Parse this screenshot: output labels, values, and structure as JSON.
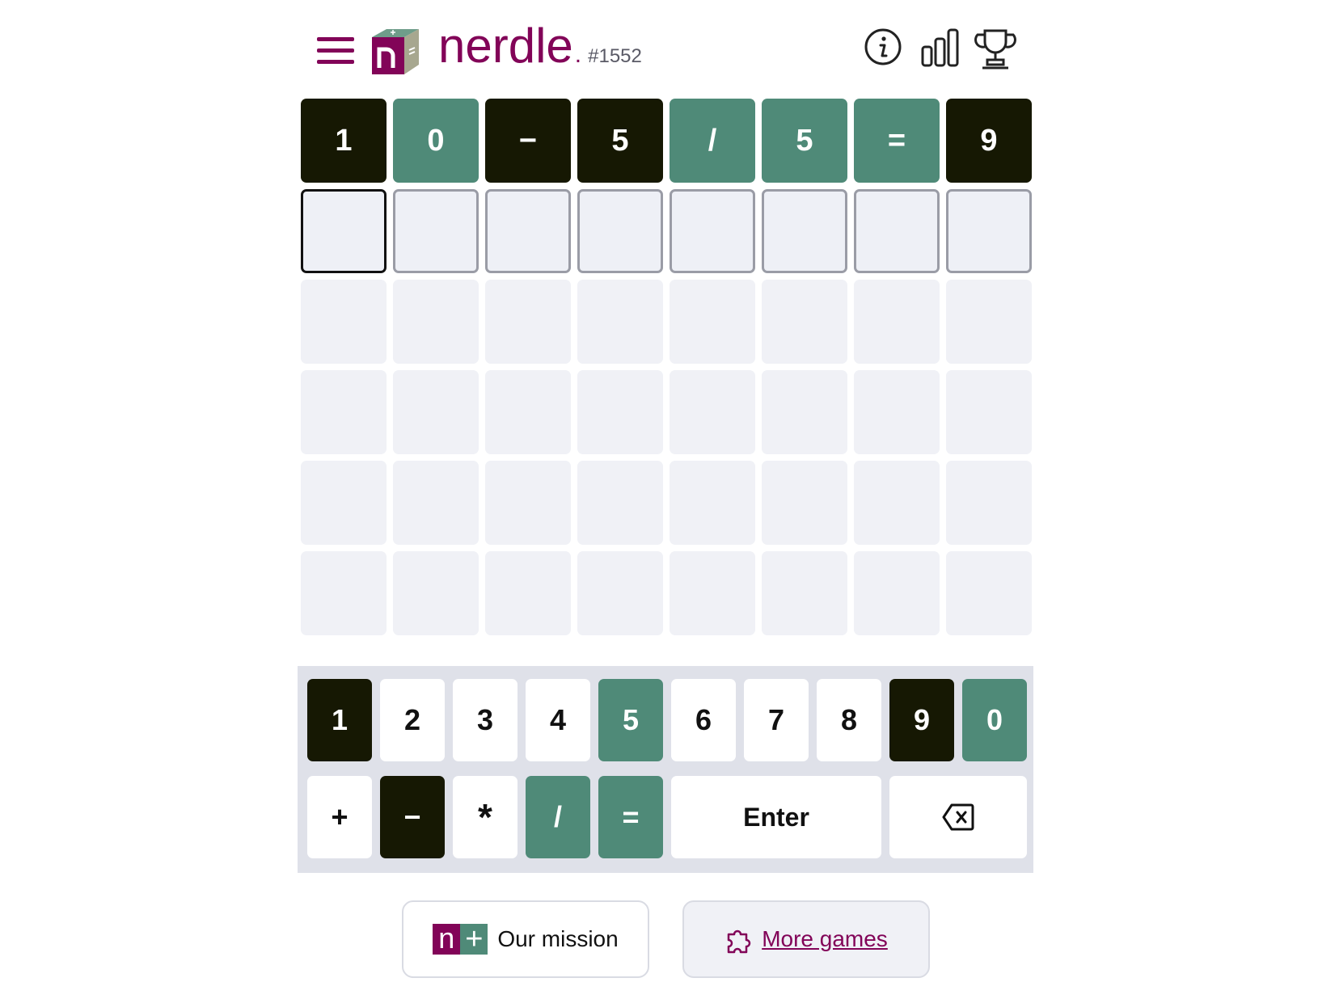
{
  "header": {
    "brand": "nerdle",
    "dot": ".",
    "puzzle_number": "#1552",
    "icons": [
      "menu-icon",
      "nerdle-logo-icon",
      "info-icon",
      "stats-icon",
      "trophy-icon"
    ]
  },
  "colors": {
    "brand": "#820458",
    "correct": "#4f8a78",
    "absent": "#161803",
    "empty": "#f0f1f6"
  },
  "board": {
    "guess_1": [
      {
        "char": "1",
        "state": "absent"
      },
      {
        "char": "0",
        "state": "present"
      },
      {
        "char": "−",
        "state": "absent"
      },
      {
        "char": "5",
        "state": "absent"
      },
      {
        "char": "/",
        "state": "present"
      },
      {
        "char": "5",
        "state": "present"
      },
      {
        "char": "=",
        "state": "present"
      },
      {
        "char": "9",
        "state": "absent"
      }
    ]
  },
  "keyboard": {
    "row1": [
      {
        "label": "1",
        "state": "absent"
      },
      {
        "label": "2",
        "state": "unused"
      },
      {
        "label": "3",
        "state": "unused"
      },
      {
        "label": "4",
        "state": "unused"
      },
      {
        "label": "5",
        "state": "present"
      },
      {
        "label": "6",
        "state": "unused"
      },
      {
        "label": "7",
        "state": "unused"
      },
      {
        "label": "8",
        "state": "unused"
      },
      {
        "label": "9",
        "state": "absent"
      },
      {
        "label": "0",
        "state": "present"
      }
    ],
    "row2": [
      {
        "label": "+",
        "state": "unused"
      },
      {
        "label": "−",
        "state": "absent"
      },
      {
        "label": "*",
        "state": "unused"
      },
      {
        "label": "/",
        "state": "present"
      },
      {
        "label": "=",
        "state": "present"
      }
    ],
    "enter_label": "Enter",
    "backspace_icon": "backspace-icon"
  },
  "footer": {
    "mission_logo_n": "n",
    "mission_logo_plus": "+",
    "mission_label": "Our mission",
    "more_games_label": "More games",
    "more_games_icon": "puzzle-icon"
  }
}
